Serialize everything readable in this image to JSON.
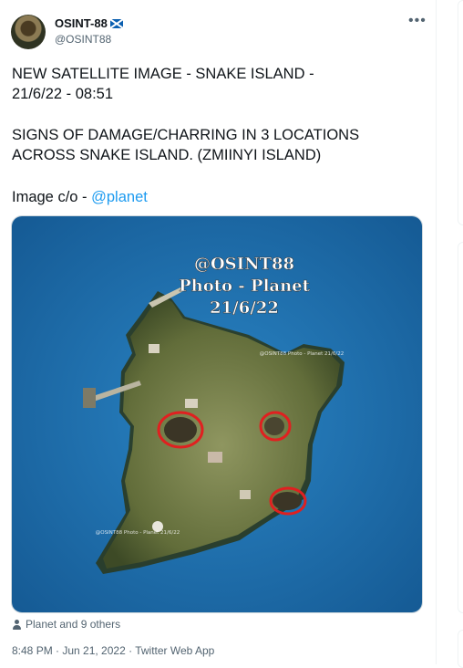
{
  "author": {
    "display_name": "OSINT-88",
    "handle": "@OSINT88",
    "flag_icon": "scotland-flag-icon"
  },
  "more_icon": "more-horizontal-icon",
  "tweet": {
    "line1": "NEW SATELLITE IMAGE - SNAKE ISLAND -\n21/6/22 - 08:51",
    "line2": "SIGNS OF DAMAGE/CHARRING IN 3 LOCATIONS\nACROSS SNAKE ISLAND. (ZMIINYI ISLAND)",
    "credit_prefix": "Image c/o - ",
    "credit_mention": "@planet"
  },
  "media": {
    "overlay_line1": "@OSINT88",
    "overlay_line2": "Photo - Planet",
    "overlay_line3": "21/6/22",
    "small_watermark_1": "@OSINT88 Photo - Planet 21/6/22",
    "small_watermark_2": "@OSINT88 Photo - Planet 21/6/22",
    "colors": {
      "sea": "#1f74b5",
      "island": "#6f7b45",
      "circle": "#e02020"
    }
  },
  "likes": {
    "text": "Planet and 9 others",
    "icon": "person-icon"
  },
  "meta": {
    "text": "8:48 PM · Jun 21, 2022 · Twitter Web App"
  }
}
